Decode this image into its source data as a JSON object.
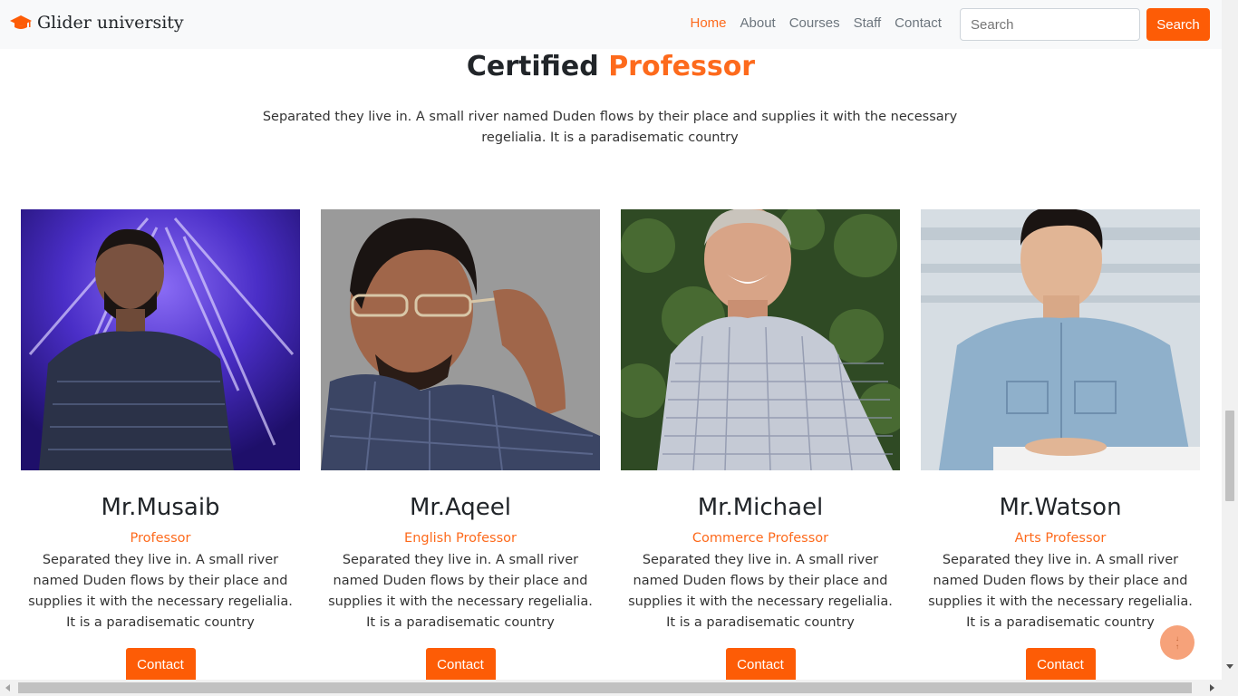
{
  "navbar": {
    "brand": "Glider university",
    "brand_icon": "graduation-cap-icon",
    "links": [
      {
        "label": "Home",
        "active": true
      },
      {
        "label": "About",
        "active": false
      },
      {
        "label": "Courses",
        "active": false
      },
      {
        "label": "Staff",
        "active": false
      },
      {
        "label": "Contact",
        "active": false
      }
    ],
    "search_placeholder": "Search",
    "search_button": "Search"
  },
  "section": {
    "title_plain": "Certified",
    "title_accent": "Professor",
    "description": "Separated they live in. A small river named Duden flows by their place and supplies it with the necessary regelialia. It is a paradisematic country"
  },
  "professors": [
    {
      "name": "Mr.Musaib",
      "role": "Professor",
      "bio": "Separated they live in. A small river named Duden flows by their place and supplies it with the necessary regelialia. It is a paradisematic country",
      "button": "Contact"
    },
    {
      "name": "Mr.Aqeel",
      "role": "English Professor",
      "bio": "Separated they live in. A small river named Duden flows by their place and supplies it with the necessary regelialia. It is a paradisematic country",
      "button": "Contact"
    },
    {
      "name": "Mr.Michael",
      "role": "Commerce Professor",
      "bio": "Separated they live in. A small river named Duden flows by their place and supplies it with the necessary regelialia. It is a paradisematic country",
      "button": "Contact"
    },
    {
      "name": "Mr.Watson",
      "role": "Arts Professor",
      "bio": "Separated they live in. A small river named Duden flows by their place and supplies it with the necessary regelialia. It is a paradisematic country",
      "button": "Contact"
    }
  ],
  "scroll_top_icon": "arrow-up-icon",
  "colors": {
    "accent": "#fd6a1c",
    "button": "#fd5c06",
    "navbar_bg": "#f8f9fa"
  }
}
